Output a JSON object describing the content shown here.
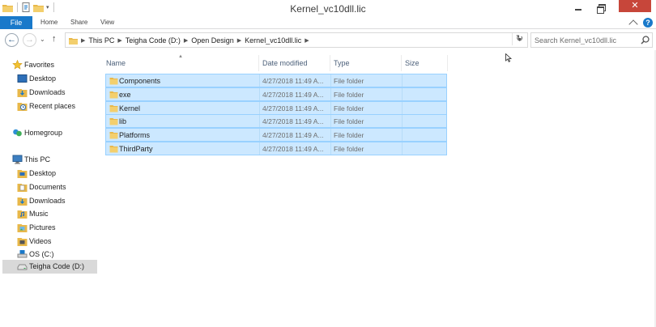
{
  "window": {
    "title": "Kernel_vc10dll.lic",
    "close_glyph": "✕"
  },
  "ribbon": {
    "file_tab": "File",
    "tabs": [
      "Home",
      "Share",
      "View"
    ],
    "help_glyph": "?"
  },
  "navigation": {
    "back_glyph": "←",
    "forward_glyph": "→",
    "recent_glyph": "⌄",
    "up_glyph": "↑",
    "breadcrumbs": [
      "This PC",
      "Teigha Code (D:)",
      "Open Design",
      "Kernel_vc10dll.lic"
    ],
    "search_placeholder": "Search Kernel_vc10dll.lic",
    "refresh_glyph": "↻"
  },
  "sidebar": {
    "favorites_label": "Favorites",
    "favorites": [
      "Desktop",
      "Downloads",
      "Recent places"
    ],
    "homegroup_label": "Homegroup",
    "thispc_label": "This PC",
    "thispc_items": [
      "Desktop",
      "Documents",
      "Downloads",
      "Music",
      "Pictures",
      "Videos",
      "OS (C:)",
      "Teigha Code (D:)"
    ],
    "selected_item": "Teigha Code (D:)"
  },
  "columns": {
    "name": "Name",
    "date": "Date modified",
    "type": "Type",
    "size": "Size"
  },
  "files": [
    {
      "name": "Components",
      "date": "4/27/2018 11:49 A...",
      "type": "File folder"
    },
    {
      "name": "exe",
      "date": "4/27/2018 11:49 A...",
      "type": "File folder"
    },
    {
      "name": "Kernel",
      "date": "4/27/2018 11:49 A...",
      "type": "File folder"
    },
    {
      "name": "lib",
      "date": "4/27/2018 11:49 A...",
      "type": "File folder"
    },
    {
      "name": "Platforms",
      "date": "4/27/2018 11:49 A...",
      "type": "File folder"
    },
    {
      "name": "ThirdParty",
      "date": "4/27/2018 11:49 A...",
      "type": "File folder"
    }
  ],
  "colors": {
    "accent": "#1979ca",
    "selection_fill": "#cce8ff",
    "selection_border": "#99d1ff",
    "folder": "#e8b84a",
    "close_button": "#c7463a"
  },
  "icons": {
    "favorites": "star-icon",
    "desktop": "desktop-icon",
    "downloads": "downloads-icon",
    "recent": "recent-places-icon",
    "homegroup": "homegroup-icon",
    "thispc": "computer-icon",
    "folder": "folder-icon",
    "drive": "drive-icon"
  }
}
